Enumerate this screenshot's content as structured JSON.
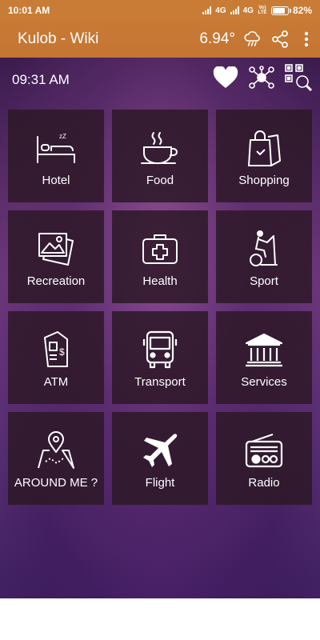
{
  "status_bar": {
    "time": "10:01 AM",
    "network_1": "4G",
    "network_2": "4G",
    "volte": "Vo) LTE",
    "battery": "82%",
    "battery_level": 0.82
  },
  "app_bar": {
    "title": "Kulob - Wiki",
    "temperature": "6.94°",
    "weather_icon": "rain-cloud-icon",
    "share_icon": "share-icon",
    "menu_icon": "more-vert-icon"
  },
  "header": {
    "clock": "09:31 AM",
    "icons": [
      "heart-icon",
      "network-icon",
      "qr-search-icon"
    ]
  },
  "tiles": [
    {
      "label": "Hotel",
      "icon": "bed-icon"
    },
    {
      "label": "Food",
      "icon": "coffee-cup-icon"
    },
    {
      "label": "Shopping",
      "icon": "shopping-bag-icon"
    },
    {
      "label": "Recreation",
      "icon": "photos-icon"
    },
    {
      "label": "Health",
      "icon": "first-aid-kit-icon"
    },
    {
      "label": "Sport",
      "icon": "exercise-bike-icon"
    },
    {
      "label": "ATM",
      "icon": "atm-machine-icon"
    },
    {
      "label": "Transport",
      "icon": "bus-icon"
    },
    {
      "label": "Services",
      "icon": "bank-building-icon"
    },
    {
      "label": "AROUND ME ?",
      "icon": "map-pin-icon"
    },
    {
      "label": "Flight",
      "icon": "airplane-icon"
    },
    {
      "label": "Radio",
      "icon": "radio-icon"
    }
  ],
  "colors": {
    "accent": "#c97c35",
    "tile_background": "#2d1928",
    "background": "#5c2f76"
  }
}
